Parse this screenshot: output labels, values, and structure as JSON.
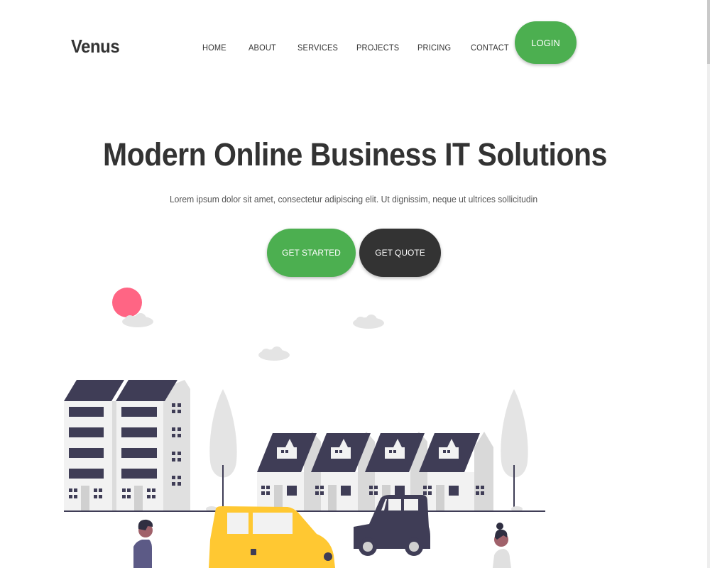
{
  "brand": {
    "name": "Venus"
  },
  "nav": {
    "items": [
      "HOME",
      "ABOUT",
      "SERVICES",
      "PROJECTS",
      "PRICING",
      "CONTACT"
    ],
    "login_label": "LOGIN"
  },
  "hero": {
    "title": "Modern Online Business IT Solutions",
    "subtitle": "Lorem ipsum dolor sit amet, consectetur adipiscing elit. Ut dignissim, neque ut ultrices sollicitudin",
    "primary_cta": "GET STARTED",
    "secondary_cta": "GET QUOTE"
  },
  "colors": {
    "accent": "#4caf50",
    "dark": "#333333",
    "roof": "#3f3d56",
    "sun": "#ff6584",
    "car": "#ffc832"
  }
}
